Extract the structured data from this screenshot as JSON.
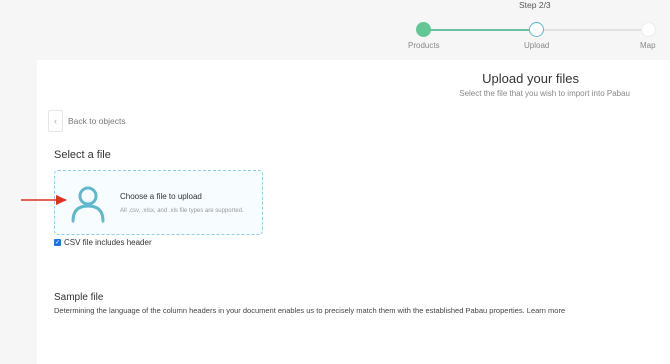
{
  "stepper": {
    "step_count": "Step 2/3",
    "steps": [
      {
        "label": "Products",
        "state": "complete"
      },
      {
        "label": "Upload",
        "state": "current"
      },
      {
        "label": "Map",
        "state": "upcoming"
      }
    ]
  },
  "header": {
    "title": "Upload your files",
    "subtitle": "Select the file that you wish to import into Pabau"
  },
  "nav": {
    "back_label": "Back to objects",
    "back_icon": "chevron-left-icon"
  },
  "upload": {
    "section_title": "Select a file",
    "icon": "person-icon",
    "title": "Choose a file to upload",
    "supported": "All .csv, .xlsx, and .xls file types are supported."
  },
  "csv_option": {
    "label": "CSV file includes header",
    "checked": true
  },
  "sample": {
    "title": "Sample file",
    "description": "Determining the language of the column headers in your document enables us to precisely match them with the established Pabau properties. Learn more"
  },
  "colors": {
    "accent": "#5fb8cc",
    "complete": "#62c795",
    "annotation": "#e0301e",
    "checkbox": "#1a73e8"
  }
}
